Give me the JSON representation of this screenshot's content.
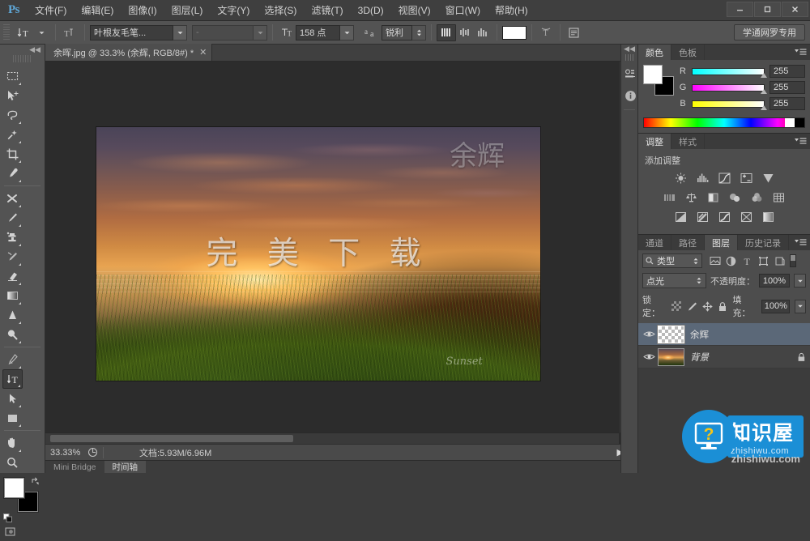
{
  "app": {
    "logo_text": "Ps",
    "menus": [
      "文件(F)",
      "编辑(E)",
      "图像(I)",
      "图层(L)",
      "文字(Y)",
      "选择(S)",
      "滤镜(T)",
      "3D(D)",
      "视图(V)",
      "窗口(W)",
      "帮助(H)"
    ]
  },
  "window_controls": {
    "minimize": "—",
    "maximize": "▢",
    "close": "✕"
  },
  "options_bar": {
    "tool_preset_label": "↓T",
    "orientation_label": "⇅T",
    "font_family": "叶根友毛笔...",
    "font_style": "-",
    "size_icon": "tT",
    "font_size": "158 点",
    "antialias_label": "aa",
    "antialias_value": "锐利",
    "align_left": "align-vertical-top",
    "align_center": "align-vertical-center",
    "align_right": "align-vertical-bottom",
    "text_color": "#ffffff",
    "warp_label": "warp-text",
    "panels_label": "toggle-panels",
    "workspace": "学通网罗专用"
  },
  "toolbar": {
    "collapse": "◀◀",
    "tools": [
      {
        "name": "rectangular-marquee-tool",
        "selected": false
      },
      {
        "name": "move-tool",
        "selected": false
      },
      {
        "name": "lasso-tool",
        "selected": false
      },
      {
        "name": "magic-wand-tool",
        "selected": false
      },
      {
        "name": "crop-tool",
        "selected": false
      },
      {
        "name": "eyedropper-tool",
        "selected": false
      },
      {
        "name": "spot-healing-brush-tool",
        "selected": false
      },
      {
        "name": "brush-tool",
        "selected": false
      },
      {
        "name": "clone-stamp-tool",
        "selected": false
      },
      {
        "name": "history-brush-tool",
        "selected": false
      },
      {
        "name": "eraser-tool",
        "selected": false
      },
      {
        "name": "gradient-tool",
        "selected": false
      },
      {
        "name": "blur-tool",
        "selected": false
      },
      {
        "name": "dodge-tool",
        "selected": false
      },
      {
        "name": "pen-tool",
        "selected": false
      },
      {
        "name": "type-tool",
        "selected": true
      },
      {
        "name": "path-selection-tool",
        "selected": false
      },
      {
        "name": "rectangle-tool",
        "selected": false
      },
      {
        "name": "hand-tool",
        "selected": false
      },
      {
        "name": "zoom-tool",
        "selected": false
      }
    ],
    "foreground_color": "#ffffff",
    "background_color": "#000000"
  },
  "document": {
    "tab_title": "余晖.jpg @ 33.3% (余辉, RGB/8#) *",
    "close_glyph": "✕",
    "watermark_center": "完 美 下 载",
    "watermark_corner": "余辉",
    "watermark_signature": "Sunset"
  },
  "status_bar": {
    "zoom": "33.33%",
    "doc_info": "文档:5.93M/6.96M",
    "arrow": "▶"
  },
  "bottom_tabs": [
    {
      "label": "Mini Bridge",
      "active": false
    },
    {
      "label": "时间轴",
      "active": true
    }
  ],
  "rail": {
    "collapse": "◀◀",
    "buttons": [
      {
        "name": "properties-icon"
      },
      {
        "name": "info-icon"
      }
    ]
  },
  "color_panel": {
    "tabs": [
      {
        "label": "颜色",
        "active": true
      },
      {
        "label": "色板",
        "active": false
      }
    ],
    "menu_icon": "panel-menu-icon",
    "channels": [
      {
        "label": "R",
        "value": "255"
      },
      {
        "label": "G",
        "value": "255"
      },
      {
        "label": "B",
        "value": "255"
      }
    ],
    "foreground_color": "#ffffff",
    "background_color": "#000000"
  },
  "adjustments_panel": {
    "tabs": [
      {
        "label": "调整",
        "active": true
      },
      {
        "label": "样式",
        "active": false
      }
    ],
    "title": "添加调整",
    "rows": [
      [
        {
          "name": "brightness-contrast-icon",
          "glyph": "☀"
        },
        {
          "name": "levels-icon",
          "glyph": "▥"
        },
        {
          "name": "curves-icon",
          "glyph": "∿"
        },
        {
          "name": "exposure-icon",
          "glyph": "±"
        },
        {
          "name": "vibrance-icon",
          "glyph": "▽"
        }
      ],
      [
        {
          "name": "hue-saturation-icon",
          "glyph": "▤"
        },
        {
          "name": "color-balance-icon",
          "glyph": "⚖"
        },
        {
          "name": "black-white-icon",
          "glyph": "◧"
        },
        {
          "name": "photo-filter-icon",
          "glyph": "◕"
        },
        {
          "name": "channel-mixer-icon",
          "glyph": "◉"
        },
        {
          "name": "color-lookup-icon",
          "glyph": "▦"
        }
      ],
      [
        {
          "name": "invert-icon",
          "glyph": "◑"
        },
        {
          "name": "posterize-icon",
          "glyph": "◨"
        },
        {
          "name": "threshold-icon",
          "glyph": "◣"
        },
        {
          "name": "selective-color-icon",
          "glyph": "⧗"
        },
        {
          "name": "gradient-map-icon",
          "glyph": "▩"
        }
      ]
    ]
  },
  "layers_panel": {
    "tabs": [
      {
        "label": "通道",
        "active": false
      },
      {
        "label": "路径",
        "active": false
      },
      {
        "label": "图层",
        "active": true
      },
      {
        "label": "历史记录",
        "active": false
      }
    ],
    "filter_label": "类型",
    "filter_icons": [
      {
        "name": "filter-pixel-icon"
      },
      {
        "name": "filter-adjustment-icon"
      },
      {
        "name": "filter-type-icon"
      },
      {
        "name": "filter-shape-icon"
      },
      {
        "name": "filter-smartobject-icon"
      }
    ],
    "blend_mode": "点光",
    "opacity_label": "不透明度：",
    "opacity_value": "100%",
    "lock_label": "锁定：",
    "lock_icons": [
      {
        "name": "lock-transparent-pixels-icon"
      },
      {
        "name": "lock-image-pixels-icon"
      },
      {
        "name": "lock-position-icon"
      },
      {
        "name": "lock-all-icon"
      }
    ],
    "fill_label": "填充：",
    "fill_value": "100%",
    "layers": [
      {
        "name": "余辉",
        "visible": true,
        "selected": true,
        "thumb": "transparent",
        "locked": false,
        "italic": false
      },
      {
        "name": "背景",
        "visible": true,
        "selected": false,
        "thumb": "photo",
        "locked": true,
        "italic": true
      }
    ]
  },
  "watermark_logo": {
    "cn": "知识屋",
    "url": "zhishiwu.com",
    "footer": "zhishiwu.com"
  }
}
